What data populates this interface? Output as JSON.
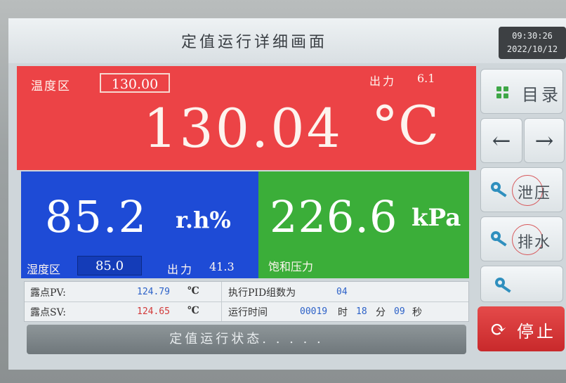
{
  "header": {
    "title": "定值运行详细画面",
    "time": "09:30:26",
    "date": "2022/10/12"
  },
  "temperature": {
    "zone_label": "温度区",
    "sv": "130.00",
    "output_label": "出力",
    "output_value": "6.1",
    "pv": "130.04",
    "unit": "°C"
  },
  "humidity": {
    "pv": "85.2",
    "unit": "r.h%",
    "zone_label": "湿度区",
    "sv": "85.0",
    "output_label": "出力",
    "output_value": "41.3"
  },
  "pressure": {
    "pv": "226.6",
    "unit": "kPa",
    "label": "饱和压力"
  },
  "info": {
    "dew_pv_label": "露点PV:",
    "dew_pv_value": "124.79",
    "dew_sv_label": "露点SV:",
    "dew_sv_value": "124.65",
    "unit_c": "℃",
    "pid_label": "执行PID组数为",
    "pid_value": "04",
    "run_time_label": "运行时间",
    "run_time_hours": "00019",
    "hour_label": "时",
    "run_time_minutes": "18",
    "minute_label": "分",
    "run_time_seconds": "09",
    "second_label": "秒"
  },
  "status": {
    "text": "定值运行状态. . . . ."
  },
  "buttons": {
    "menu": "目录",
    "left_arrow": "←",
    "right_arrow": "→",
    "vent": "泄压",
    "drain": "排水",
    "stop": "停止"
  },
  "colors": {
    "temperature_panel": "#ec4346",
    "humidity_panel": "#1e4bd6",
    "pressure_panel": "#3bae39",
    "stop_button": "#d63435"
  }
}
